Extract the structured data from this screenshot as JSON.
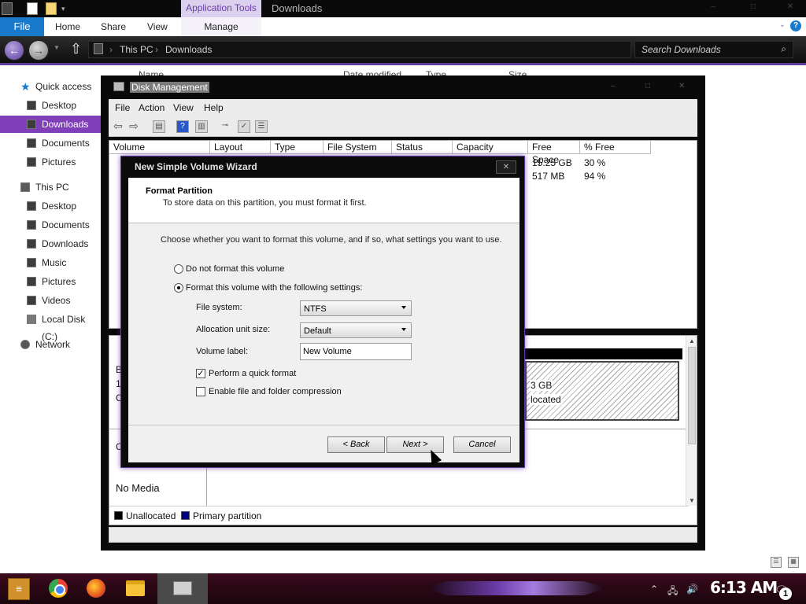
{
  "explorer": {
    "context_tab": "Application Tools",
    "window_title": "Downloads",
    "ribbon": {
      "file": "File",
      "tabs": [
        "Home",
        "Share",
        "View"
      ],
      "context_tab": "Manage"
    },
    "address": {
      "crumbs": [
        "This PC",
        "Downloads"
      ],
      "search_placeholder": "Search Downloads"
    },
    "columns": [
      "Name",
      "Date modified",
      "Type",
      "Size"
    ],
    "nav": {
      "quick_access": "Quick access",
      "quick_items": [
        "Desktop",
        "Downloads",
        "Documents",
        "Pictures"
      ],
      "this_pc": "This PC",
      "pc_items": [
        "Desktop",
        "Documents",
        "Downloads",
        "Music",
        "Pictures",
        "Videos",
        "Local Disk (C:)"
      ],
      "network": "Network",
      "selected": "Downloads"
    }
  },
  "disk_management": {
    "title": "Disk Management",
    "menu": [
      "File",
      "Action",
      "View",
      "Help"
    ],
    "volume_columns": [
      "Volume",
      "Layout",
      "Type",
      "File System",
      "Status",
      "Capacity",
      "Free Space",
      "% Free"
    ],
    "volume_rows": [
      {
        "free_space": "15.25 GB",
        "pct_free": "30 %"
      },
      {
        "free_space": "517 MB",
        "pct_free": "94 %"
      }
    ],
    "unallocated": {
      "size": "3 GB",
      "label": "located"
    },
    "disk_left_fragments": [
      "B",
      "1",
      "C"
    ],
    "cd_left_fragment": "C",
    "no_media": "No Media",
    "legend": [
      {
        "label": "Unallocated",
        "color": "#000000"
      },
      {
        "label": "Primary partition",
        "color": "#000080"
      }
    ]
  },
  "wizard": {
    "title": "New Simple Volume Wizard",
    "heading": "Format Partition",
    "subheading": "To store data on this partition, you must format it first.",
    "instructions": "Choose whether you want to format this volume, and if so, what settings you want to use.",
    "option_no_format": "Do not format this volume",
    "option_format": "Format this volume with the following settings:",
    "selected_option": "format",
    "file_system_label": "File system:",
    "file_system_value": "NTFS",
    "alloc_label": "Allocation unit size:",
    "alloc_value": "Default",
    "volume_label_label": "Volume label:",
    "volume_label_value": "New Volume",
    "quick_format_label": "Perform a quick format",
    "quick_format_checked": true,
    "compression_label": "Enable file and folder compression",
    "compression_checked": false,
    "back": "< Back",
    "next": "Next >",
    "cancel": "Cancel"
  },
  "taskbar": {
    "clock": "6:13 AM",
    "notification_count": "1"
  }
}
